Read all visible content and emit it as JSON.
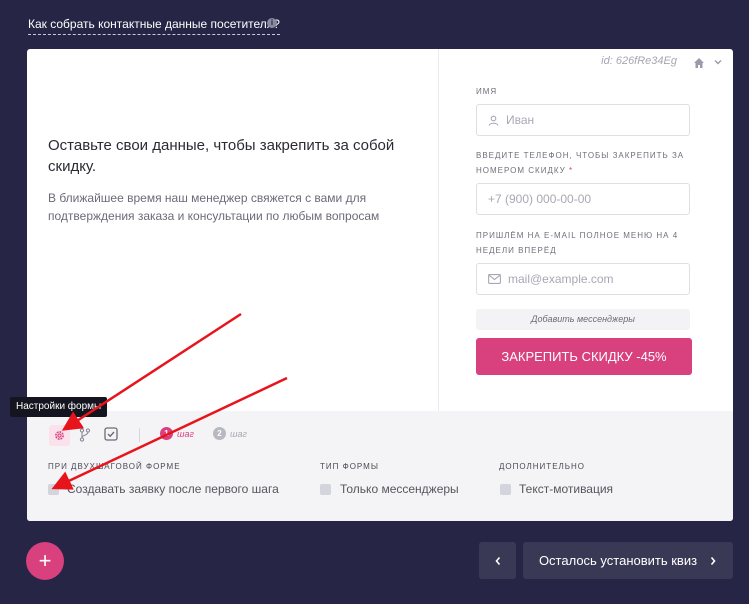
{
  "header": {
    "help_link": "Как собрать контактные данные посетителя?",
    "info_icon": "i"
  },
  "form_preview": {
    "id_label": "id: 626fRe34Eg",
    "promo_title": "Оставьте свои данные, чтобы закрепить за собой скидку.",
    "promo_text": "В ближайшее время наш менеджер свяжется с вами для подтверждения заказа и консультации по любым вопросам",
    "fields": {
      "name_label": "имя",
      "name_placeholder": "Иван",
      "phone_label": "Введите телефон, чтобы закрепить за номером скидку",
      "phone_required": "*",
      "phone_placeholder": "+7 (900) 000-00-00",
      "email_label": "Пришлём на e-mail полное меню на 4 недели вперёд",
      "email_placeholder": "mail@example.com"
    },
    "messengers_button": "Добавить мессенджеры",
    "submit_button": "ЗАКРЕПИТЬ СКИДКУ -45%"
  },
  "settings_panel": {
    "tooltip": "Настройки формы",
    "step1_number": "1",
    "step1_label": "шаг",
    "step2_number": "2",
    "step2_label": "шаг",
    "sections": {
      "two_step_label": "При двухшаговой форме",
      "two_step_option": "Создавать заявку после первого шага",
      "form_type_label": "Тип формы",
      "form_type_option": "Только мессенджеры",
      "extra_label": "Дополнительно",
      "extra_option": "Текст-мотивация"
    }
  },
  "footer": {
    "add_symbol": "+",
    "next_button": "Осталось установить квиз"
  },
  "colors": {
    "background": "#262545",
    "accent": "#d8407e",
    "dark_button": "#3a3955",
    "annotation_arrow": "#e8141c"
  }
}
